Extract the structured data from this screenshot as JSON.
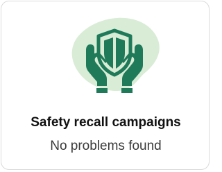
{
  "card": {
    "icon": "shield-hands-icon",
    "title": "Safety recall campaigns",
    "status": "No problems found"
  },
  "colors": {
    "icon_primary": "#1f7a5a",
    "icon_blob": "#d9ecd6",
    "title_text": "#111111",
    "status_text": "#3a3a3a",
    "border": "#dadada"
  }
}
